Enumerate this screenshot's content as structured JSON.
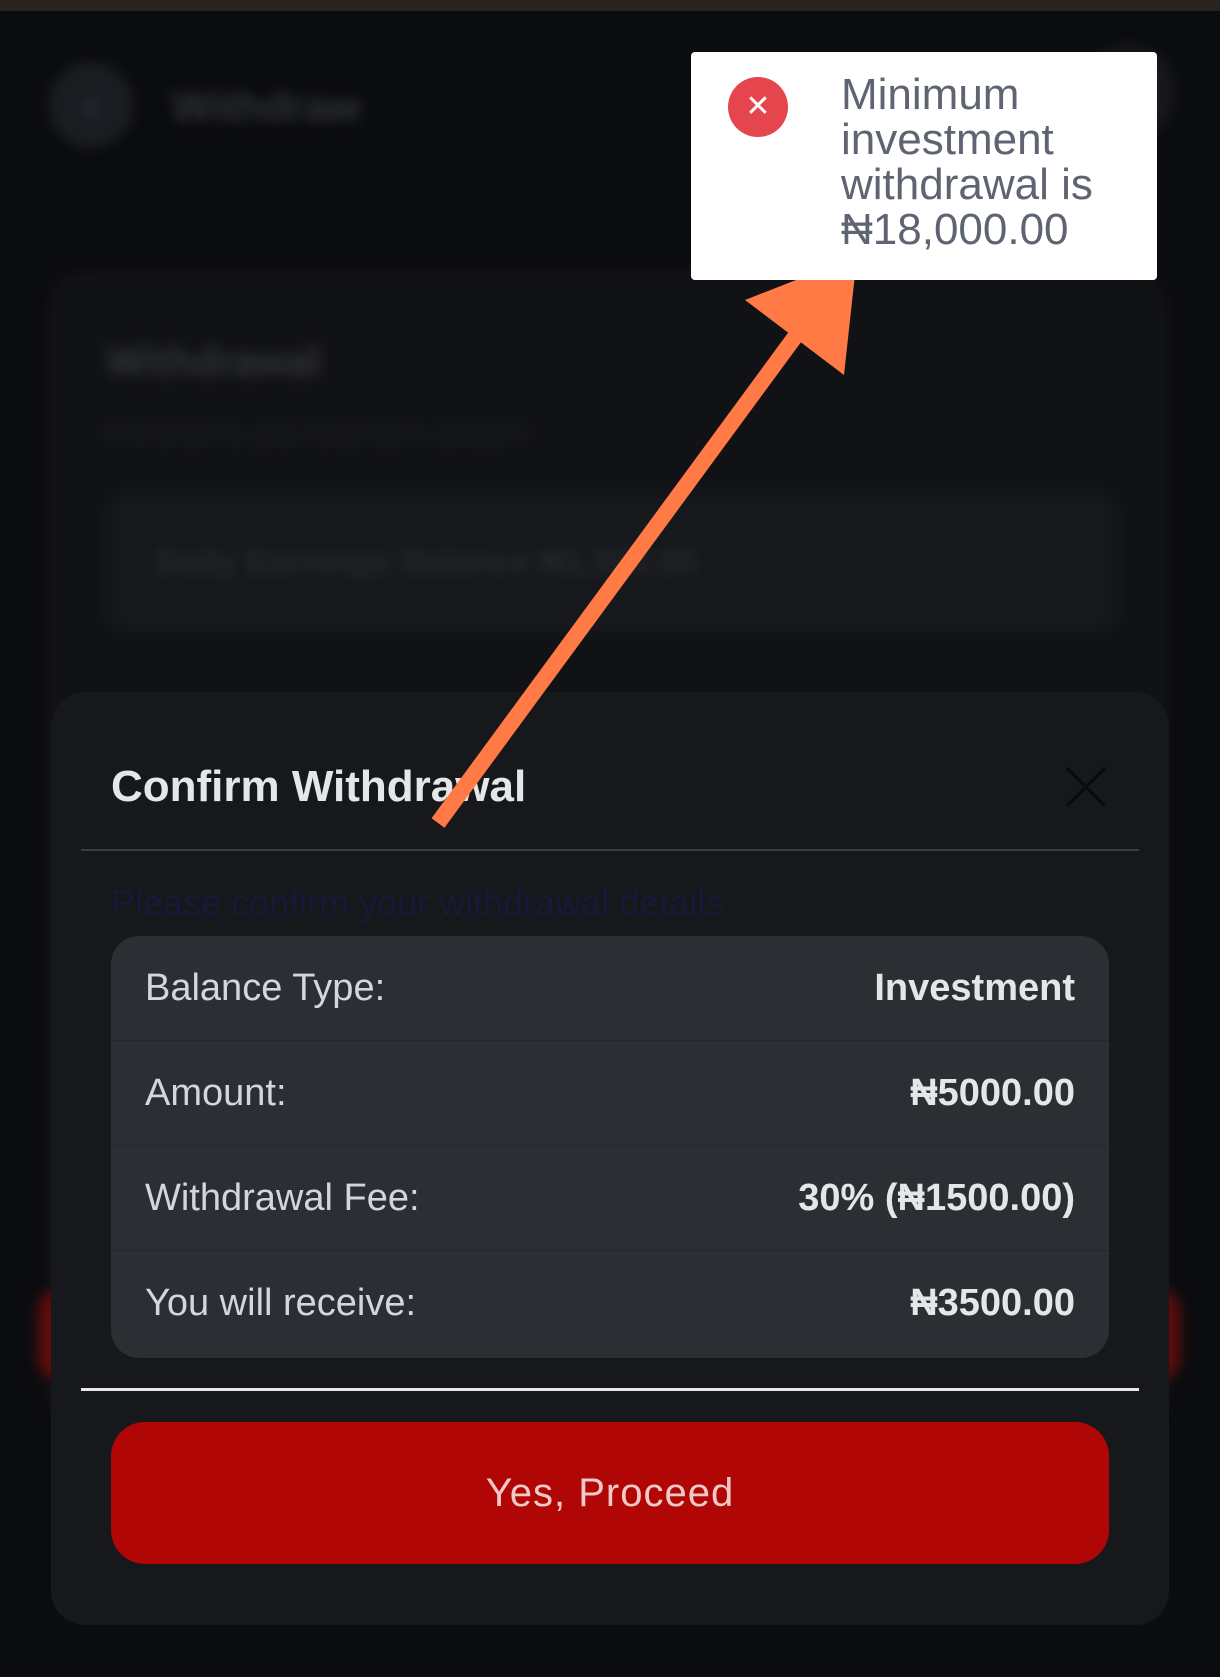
{
  "background_page": {
    "back_icon": "chevron-left-icon",
    "header_title": "Withdraw",
    "card_title": "Withdrawal",
    "card_subtitle": "Withdraw to your local bank account",
    "balance_select_value": "Daily Earnings Balance ₦1,500.00"
  },
  "modal": {
    "title": "Confirm Withdrawal",
    "close_icon": "close-icon",
    "subtitle": "Please confirm your withdrawal details",
    "details": [
      {
        "label": "Balance Type:",
        "value": "Investment"
      },
      {
        "label": "Amount:",
        "value": "₦5000.00"
      },
      {
        "label": "Withdrawal Fee:",
        "value": "30% (₦1500.00)"
      },
      {
        "label": "You will receive:",
        "value": "₦3500.00"
      }
    ],
    "proceed_label": "Yes, Proceed"
  },
  "toast": {
    "icon": "error-x-icon",
    "message": "Minimum investment withdrawal is ₦18,000.00"
  },
  "colors": {
    "page_bg": "#0b0c0f",
    "modal_bg": "#16181c",
    "details_bg": "#2b2e33",
    "proceed_button": "#b00606",
    "toast_error": "#e5454c",
    "annotation_arrow": "#ff7a45"
  }
}
